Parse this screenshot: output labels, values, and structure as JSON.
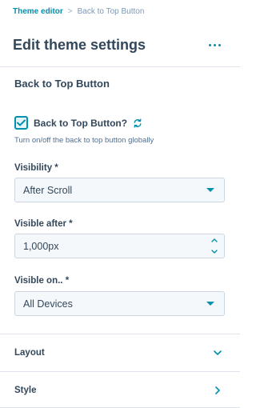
{
  "breadcrumb": {
    "parent": "Theme editor",
    "separator": ">",
    "current": "Back to Top Button"
  },
  "header": {
    "title": "Edit theme settings",
    "more_icon": "more-horizontal-icon"
  },
  "section": {
    "title": "Back to Top Button",
    "checkbox": {
      "label": "Back to Top Button?",
      "checked": true,
      "sync_icon": "sync-icon",
      "help": "Turn on/off the back to top button globally"
    },
    "visibility": {
      "label": "Visibility *",
      "value": "After Scroll"
    },
    "visible_after": {
      "label": "Visible after *",
      "value": "1,000px"
    },
    "visible_on": {
      "label": "Visible on.. *",
      "value": "All Devices"
    }
  },
  "accordions": [
    {
      "label": "Layout",
      "icon": "chevron-down-icon"
    },
    {
      "label": "Style",
      "icon": "chevron-right-icon"
    }
  ],
  "colors": {
    "accent": "#0091ae",
    "text": "#33475b",
    "border": "#cbd6e2",
    "input_bg": "#f5f8fa"
  }
}
